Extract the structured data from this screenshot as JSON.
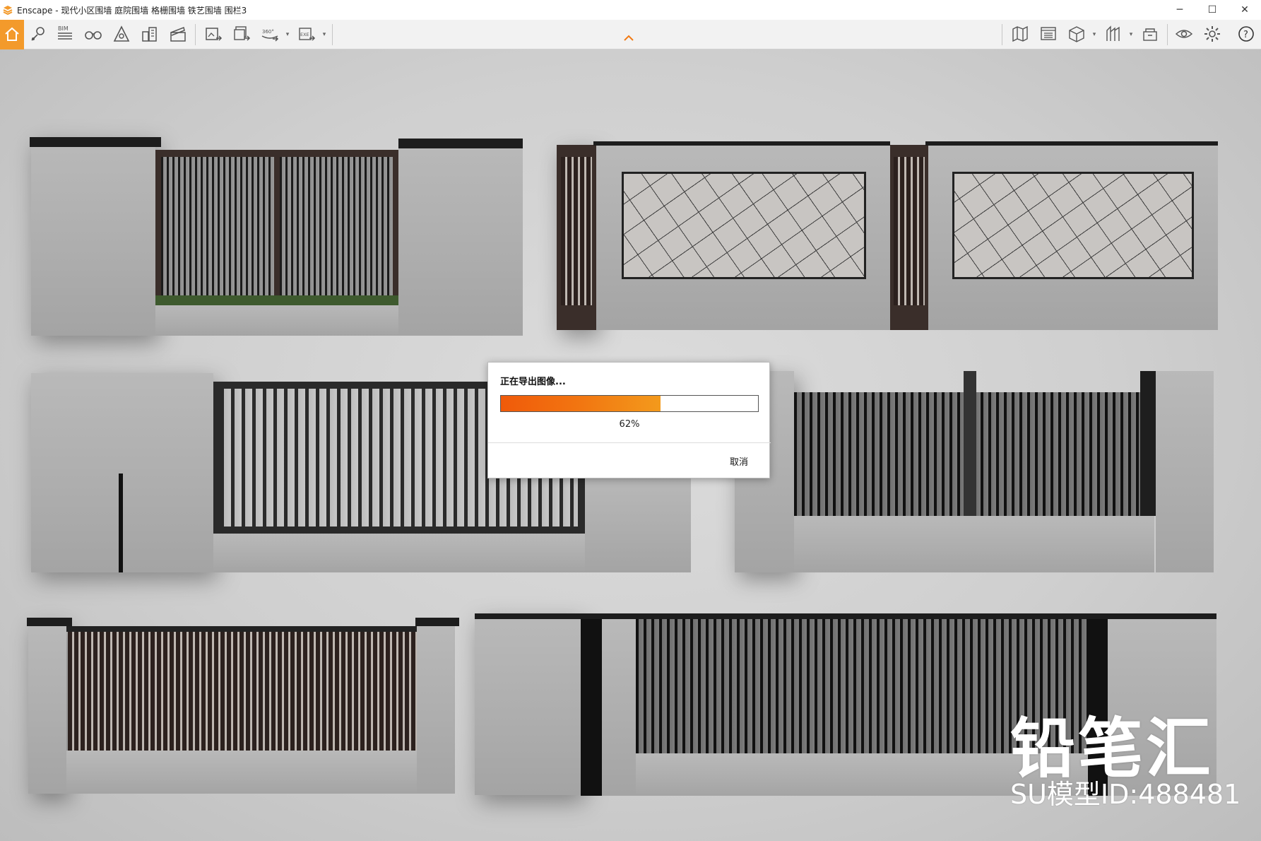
{
  "window": {
    "title": "Enscape - 现代小区围墙 庭院围墙 格栅围墙 铁艺围墙 围栏3",
    "controls": {
      "minimize": "─",
      "maximize": "☐",
      "close": "✕"
    }
  },
  "toolbar": {
    "left_icons": [
      "home-icon",
      "location-pin-icon",
      "bim-icon",
      "binoculars-icon",
      "atmosphere-icon",
      "buildings-icon",
      "clapperboard-icon",
      "export-image-icon",
      "batch-export-icon",
      "export-360-icon",
      "export-exe-icon"
    ],
    "bim_label": "BIM",
    "pano_label": "360°",
    "exe_label": "EXE",
    "right_icons": [
      "map-icon",
      "panel-icon",
      "cube-icon",
      "views-icon",
      "asset-library-icon",
      "visual-settings-icon",
      "settings-icon",
      "help-icon"
    ],
    "help_label": "?"
  },
  "dialog": {
    "title": "正在导出图像...",
    "progress_percent": 62,
    "progress_label": "62%",
    "cancel_label": "取消"
  },
  "watermark": {
    "brand": "铅笔汇",
    "model_id": "SU模型ID:488481"
  },
  "colors": {
    "accent": "#f39a2b",
    "progress_start": "#f05a0a",
    "progress_end": "#f39a1c"
  }
}
